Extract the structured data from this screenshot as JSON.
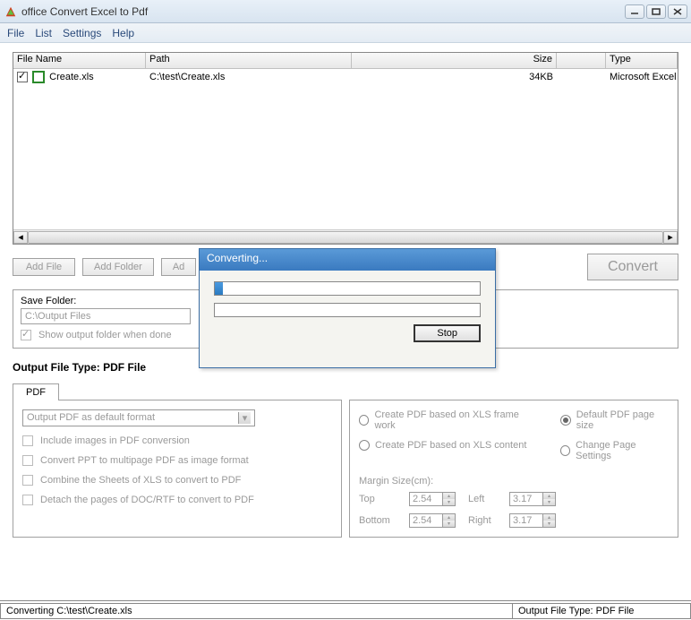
{
  "window": {
    "title": "office Convert Excel to Pdf"
  },
  "menu": {
    "file": "File",
    "list": "List",
    "settings": "Settings",
    "help": "Help"
  },
  "fileList": {
    "headers": {
      "name": "File Name",
      "path": "Path",
      "size": "Size",
      "type": "Type"
    },
    "row": {
      "name": "Create.xls",
      "path": "C:\\test\\Create.xls",
      "size": "34KB",
      "type": "Microsoft Excel"
    }
  },
  "buttons": {
    "addFile": "Add File",
    "addFolder": "Add Folder",
    "addUrl": "Ad",
    "convert": "Convert"
  },
  "saveFolder": {
    "label": "Save Folder:",
    "path": "C:\\Output Files",
    "showFolder": "Show output folder when done"
  },
  "outputType": {
    "label": "Output File Type:  PDF File",
    "tab": "PDF"
  },
  "leftPanel": {
    "dropdown": "Output PDF as default format",
    "opt1": "Include images in PDF conversion",
    "opt2": "Convert PPT to multipage PDF as image format",
    "opt3": "Combine the Sheets of XLS to convert to PDF",
    "opt4": "Detach the pages of DOC/RTF to convert to PDF"
  },
  "rightPanel": {
    "r1": "Create PDF based on XLS frame work",
    "r2": "Create PDF based on XLS content",
    "r3": "Default PDF page size",
    "r4": "Change Page Settings",
    "marginLabel": "Margin Size(cm):",
    "top": "Top",
    "left": "Left",
    "bottom": "Bottom",
    "right": "Right",
    "vTop": "2.54",
    "vLeft": "3.17",
    "vBottom": "2.54",
    "vRight": "3.17"
  },
  "status": {
    "left": "Converting  C:\\test\\Create.xls",
    "right": "Output File Type:  PDF File"
  },
  "modal": {
    "title": "Converting...",
    "stop": "Stop"
  }
}
